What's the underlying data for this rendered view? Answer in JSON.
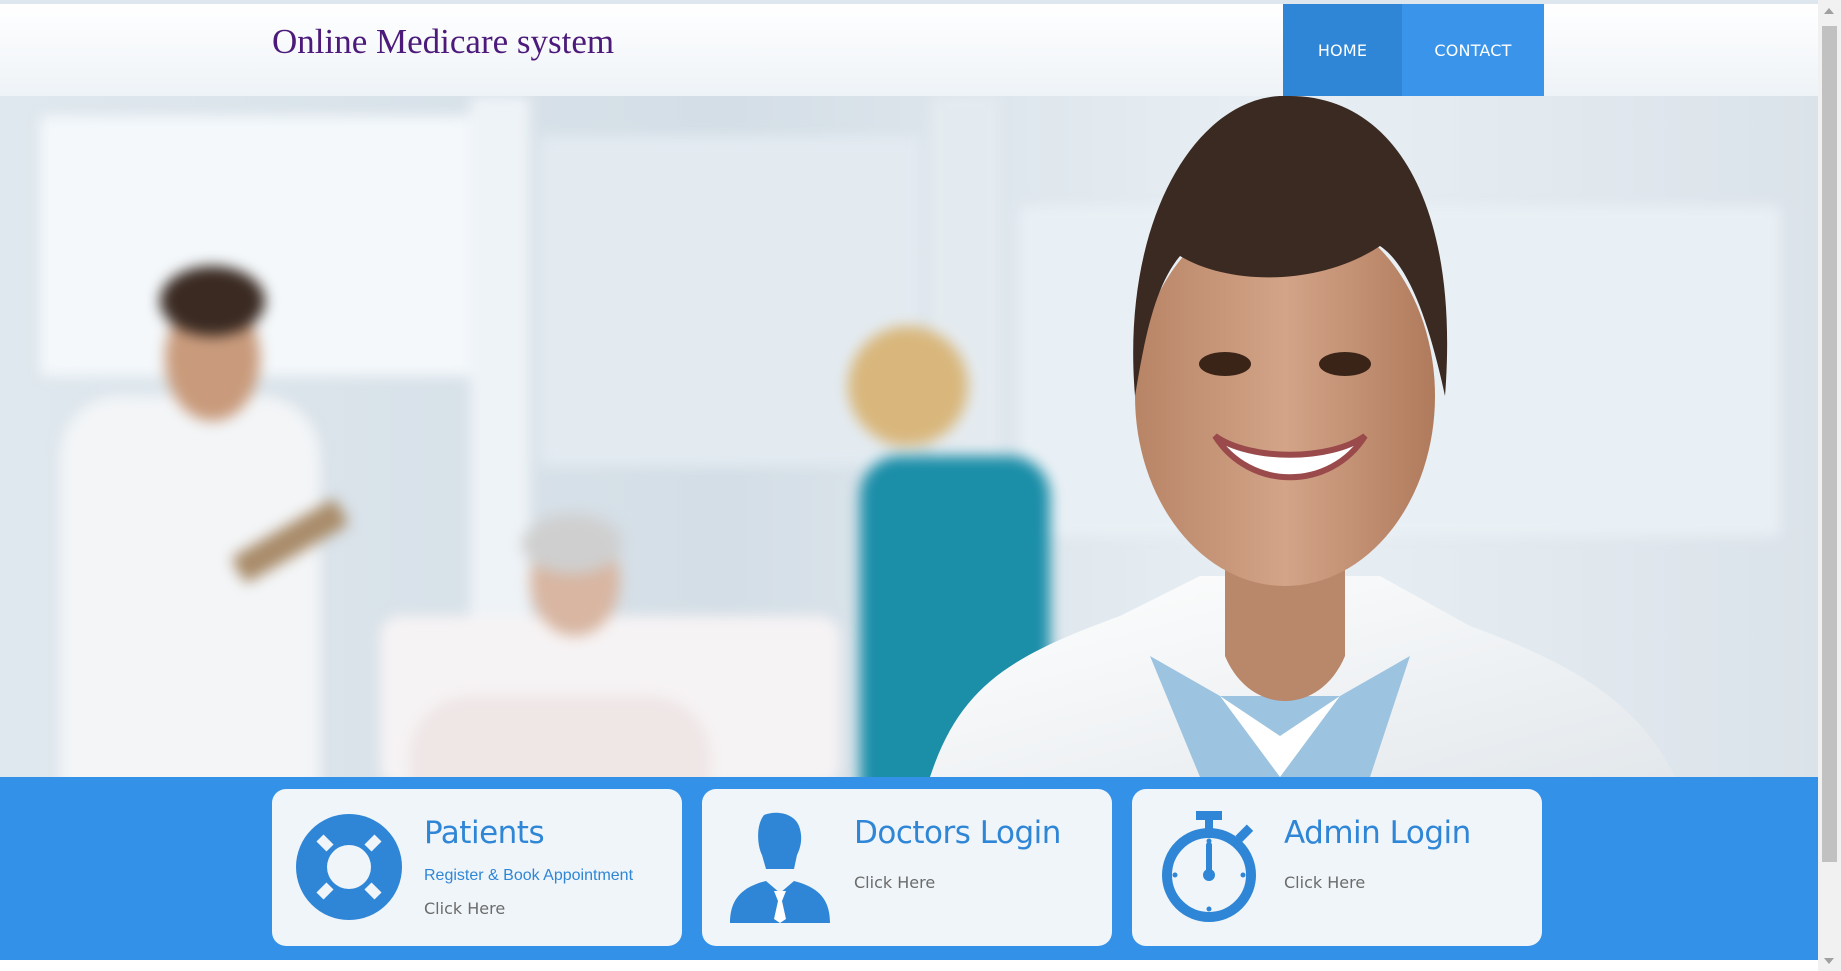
{
  "header": {
    "brand": "Online Medicare system",
    "nav": [
      {
        "label": "HOME"
      },
      {
        "label": "CONTACT"
      }
    ]
  },
  "cards": [
    {
      "title": "Patients",
      "subtitle": "Register & Book Appointment",
      "link": "Click Here",
      "icon": "lifebuoy-icon"
    },
    {
      "title": "Doctors Login",
      "link": "Click Here",
      "icon": "doctor-person-icon"
    },
    {
      "title": "Admin Login",
      "link": "Click Here",
      "icon": "stopwatch-icon"
    }
  ],
  "colors": {
    "brand_text": "#4b1a7a",
    "nav_home": "#2f86d6",
    "nav_contact": "#3a95ea",
    "band": "#3391e8",
    "card_bg": "#f0f5f9",
    "accent": "#2f86d6"
  }
}
